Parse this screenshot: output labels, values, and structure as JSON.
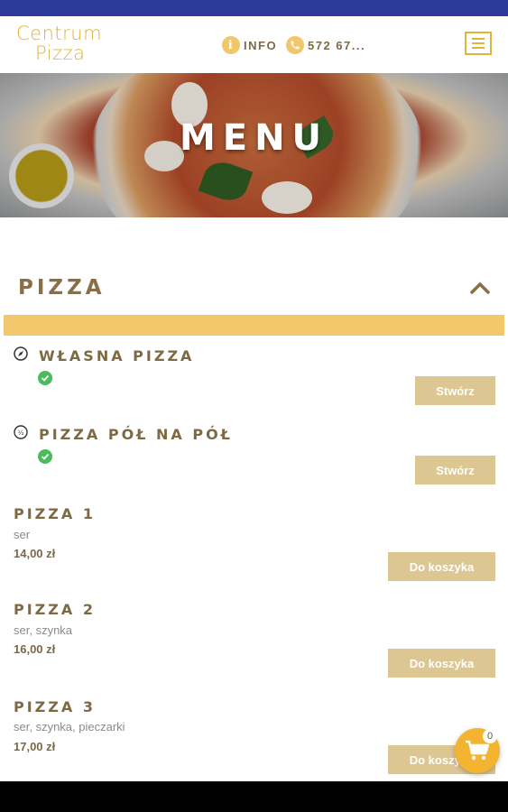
{
  "header": {
    "logo_line1": "Centrum",
    "logo_line2": "Pizza",
    "info_label": "INFO",
    "info_icon": "info-icon",
    "phone_label": "572 67...",
    "phone_icon": "phone-icon",
    "menu_icon": "hamburger-icon"
  },
  "hero": {
    "title": "MENU"
  },
  "category": {
    "title": "PIZZA",
    "toggle_icon": "chevron-up-icon",
    "accent_color": "#f3c76b"
  },
  "items": [
    {
      "name": "WŁASNA PIZZA",
      "icon": "compass-icon",
      "available_icon": "check-circle-icon",
      "button": "Stwórz"
    },
    {
      "name": "PIZZA PÓŁ NA PÓŁ",
      "icon": "half-pizza-icon",
      "available_icon": "check-circle-icon",
      "button": "Stwórz"
    },
    {
      "name": "PIZZA 1",
      "desc": "ser",
      "price": "14,00 zł",
      "button": "Do koszyka"
    },
    {
      "name": "PIZZA 2",
      "desc": "ser, szynka",
      "price": "16,00 zł",
      "button": "Do koszyka"
    },
    {
      "name": "PIZZA 3",
      "desc": "ser, szynka, pieczarki",
      "price": "17,00 zł",
      "button": "Do koszyka"
    }
  ],
  "cart": {
    "icon": "cart-icon",
    "count": "0"
  },
  "colors": {
    "brand": "#e0b43a",
    "button": "#dcc691",
    "fab": "#f2b431",
    "statusbar": "#2e3a9a"
  }
}
